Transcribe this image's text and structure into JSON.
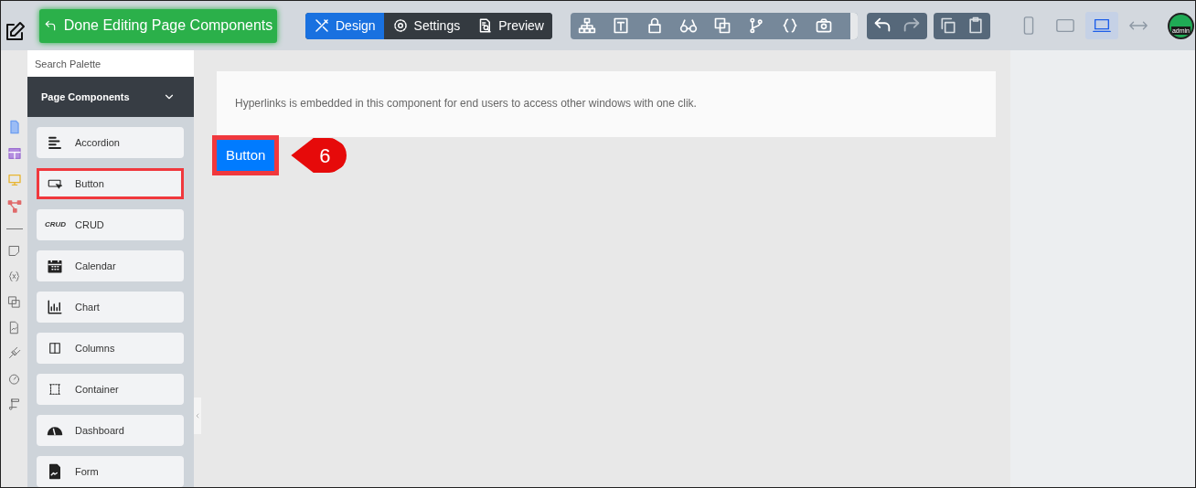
{
  "toolbar": {
    "done_button": "Done Editing Page Components",
    "modes": [
      {
        "kind": "design",
        "label": "Design",
        "selected": true
      },
      {
        "kind": "settings",
        "label": "Settings",
        "selected": false
      },
      {
        "kind": "preview",
        "label": "Preview",
        "selected": false
      }
    ],
    "devices": [
      {
        "kind": "phone",
        "selected": false
      },
      {
        "kind": "tablet",
        "selected": false
      },
      {
        "kind": "laptop",
        "selected": true
      },
      {
        "kind": "full-width",
        "selected": false
      }
    ],
    "avatar_text": "admin"
  },
  "palette": {
    "search": {
      "placeholder": "Search Palette"
    },
    "section": {
      "title": "Page Components",
      "expanded": true
    },
    "items": [
      {
        "kind": "accordion",
        "label": "Accordion",
        "highlighted": false
      },
      {
        "kind": "button",
        "label": "Button",
        "highlighted": true
      },
      {
        "kind": "crud",
        "label": "CRUD",
        "icon_text": "CRUD",
        "highlighted": false
      },
      {
        "kind": "calendar",
        "label": "Calendar",
        "highlighted": false
      },
      {
        "kind": "chart",
        "label": "Chart",
        "highlighted": false
      },
      {
        "kind": "columns",
        "label": "Columns",
        "highlighted": false
      },
      {
        "kind": "container",
        "label": "Container",
        "highlighted": false
      },
      {
        "kind": "dashboard",
        "label": "Dashboard",
        "highlighted": false
      },
      {
        "kind": "form",
        "label": "Form",
        "highlighted": false
      }
    ]
  },
  "canvas": {
    "text_component": "Hyperlinks is embedded in this component for end users to access other windows with one clik.",
    "button_component": {
      "label": "Button",
      "highlighted": true
    },
    "callout": "6"
  }
}
